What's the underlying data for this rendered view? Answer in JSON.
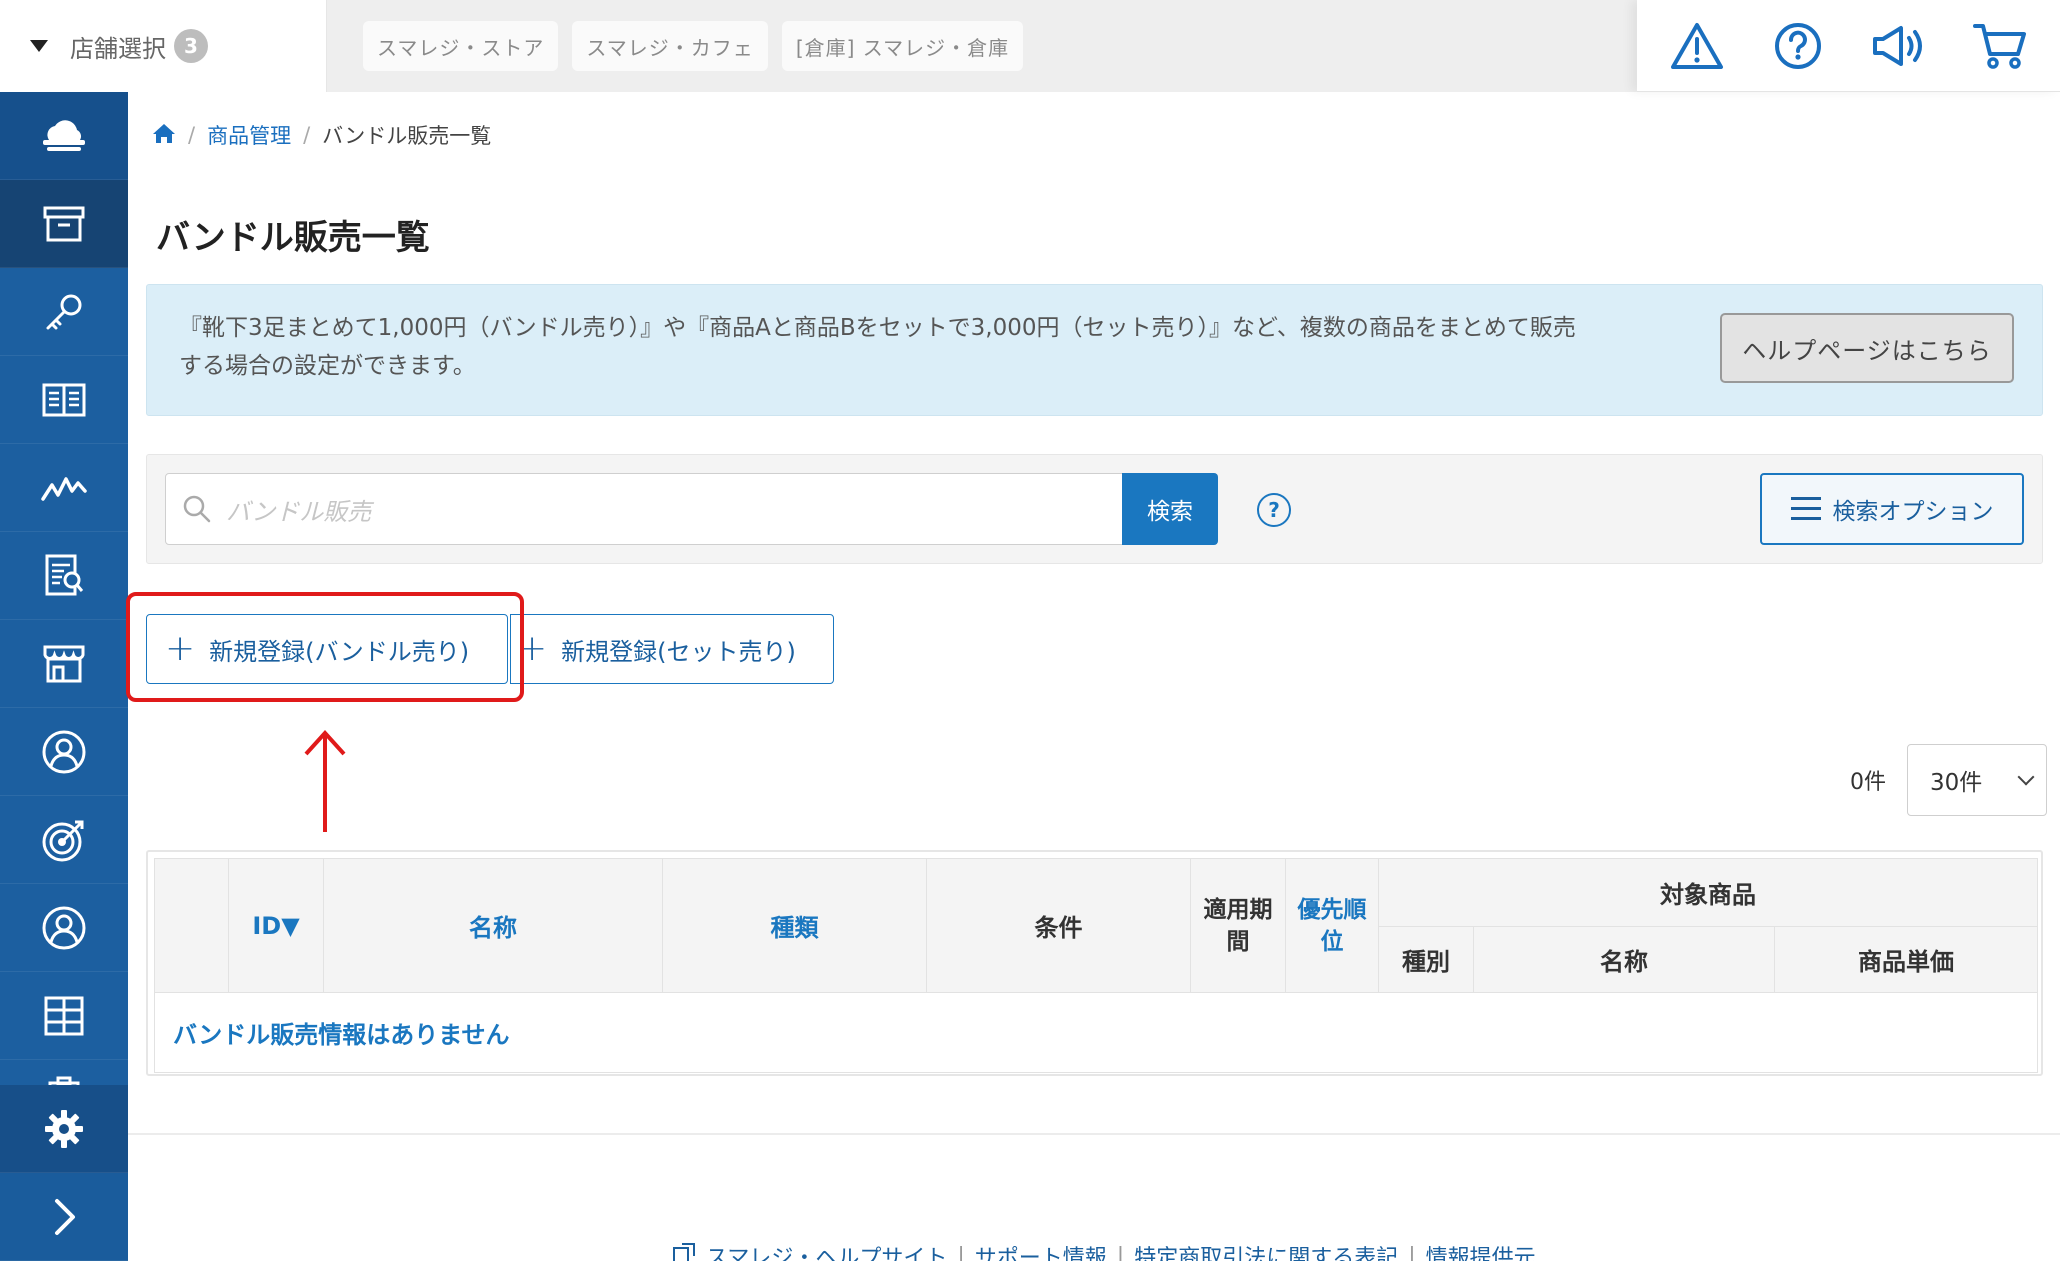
{
  "topbar": {
    "store_select_label": "店舗選択",
    "store_count": "3",
    "stores": [
      "スマレジ・ストア",
      "スマレジ・カフェ",
      "[倉庫] スマレジ・倉庫"
    ],
    "icons": [
      "warning-icon",
      "help-icon",
      "megaphone-icon",
      "cart-icon"
    ]
  },
  "sidebar": {
    "items": [
      "cloud-logo-icon",
      "archive-box-icon",
      "key-icon",
      "book-icon",
      "chart-line-icon",
      "report-icon",
      "store-icon",
      "staff-icon",
      "target-icon",
      "customer-icon",
      "grid-icon",
      "clipboard-icon"
    ],
    "active": "archive-box-icon",
    "bottom": [
      "gear-icon",
      "chevron-right-icon"
    ]
  },
  "breadcrumb": {
    "home_icon": "home-icon",
    "items": [
      "商品管理",
      "バンドル販売一覧"
    ]
  },
  "page_title": "バンドル販売一覧",
  "info": {
    "text": "『靴下3足まとめて1,000円（バンドル売り）』や『商品Aと商品Bをセットで3,000円（セット売り）』など、複数の商品をまとめて販売する場合の設定ができます。",
    "help_button": "ヘルプページはこちら"
  },
  "search": {
    "placeholder": "バンドル販売",
    "button": "検索",
    "help": "?",
    "options_button": "検索オプション"
  },
  "actions": {
    "register_bundle": "新規登録(バンドル売り)",
    "register_set": "新規登録(セット売り)"
  },
  "pagination": {
    "count": "0件",
    "per_page": "30件"
  },
  "table": {
    "headers": {
      "id": "ID▼",
      "name": "名称",
      "type": "種類",
      "condition": "条件",
      "period": "適用期間",
      "priority": "優先順位",
      "target": "対象商品",
      "target_kind": "種別",
      "target_name": "名称",
      "target_price": "商品単価"
    },
    "empty_message": "バンドル販売情報はありません"
  },
  "footer": {
    "links": [
      "スマレジ・ヘルプサイト",
      "サポート情報",
      "特定商取引法に関する表記",
      "情報提供元"
    ]
  }
}
